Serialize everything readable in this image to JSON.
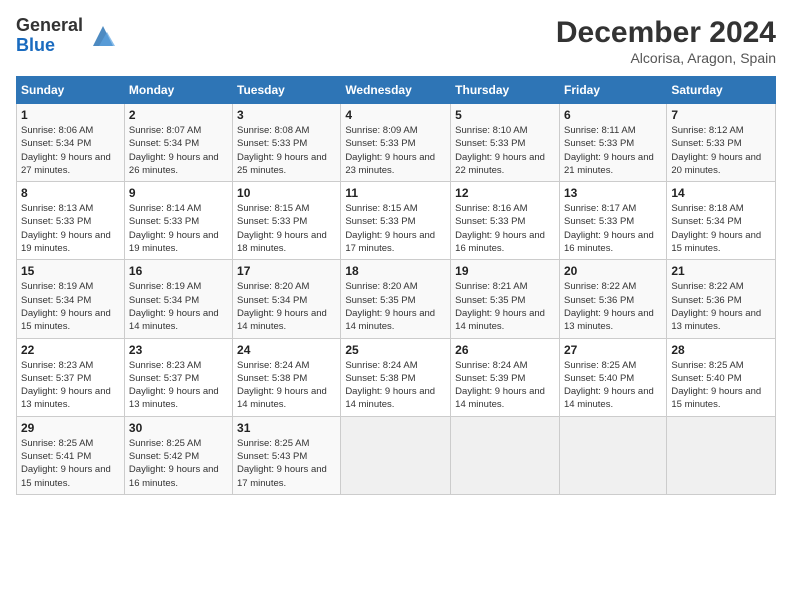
{
  "header": {
    "logo_line1": "General",
    "logo_line2": "Blue",
    "month": "December 2024",
    "location": "Alcorisa, Aragon, Spain"
  },
  "weekdays": [
    "Sunday",
    "Monday",
    "Tuesday",
    "Wednesday",
    "Thursday",
    "Friday",
    "Saturday"
  ],
  "weeks": [
    [
      {
        "day": "1",
        "sunrise": "8:06 AM",
        "sunset": "5:34 PM",
        "daylight": "9 hours and 27 minutes."
      },
      {
        "day": "2",
        "sunrise": "8:07 AM",
        "sunset": "5:34 PM",
        "daylight": "9 hours and 26 minutes."
      },
      {
        "day": "3",
        "sunrise": "8:08 AM",
        "sunset": "5:33 PM",
        "daylight": "9 hours and 25 minutes."
      },
      {
        "day": "4",
        "sunrise": "8:09 AM",
        "sunset": "5:33 PM",
        "daylight": "9 hours and 23 minutes."
      },
      {
        "day": "5",
        "sunrise": "8:10 AM",
        "sunset": "5:33 PM",
        "daylight": "9 hours and 22 minutes."
      },
      {
        "day": "6",
        "sunrise": "8:11 AM",
        "sunset": "5:33 PM",
        "daylight": "9 hours and 21 minutes."
      },
      {
        "day": "7",
        "sunrise": "8:12 AM",
        "sunset": "5:33 PM",
        "daylight": "9 hours and 20 minutes."
      }
    ],
    [
      {
        "day": "8",
        "sunrise": "8:13 AM",
        "sunset": "5:33 PM",
        "daylight": "9 hours and 19 minutes."
      },
      {
        "day": "9",
        "sunrise": "8:14 AM",
        "sunset": "5:33 PM",
        "daylight": "9 hours and 19 minutes."
      },
      {
        "day": "10",
        "sunrise": "8:15 AM",
        "sunset": "5:33 PM",
        "daylight": "9 hours and 18 minutes."
      },
      {
        "day": "11",
        "sunrise": "8:15 AM",
        "sunset": "5:33 PM",
        "daylight": "9 hours and 17 minutes."
      },
      {
        "day": "12",
        "sunrise": "8:16 AM",
        "sunset": "5:33 PM",
        "daylight": "9 hours and 16 minutes."
      },
      {
        "day": "13",
        "sunrise": "8:17 AM",
        "sunset": "5:33 PM",
        "daylight": "9 hours and 16 minutes."
      },
      {
        "day": "14",
        "sunrise": "8:18 AM",
        "sunset": "5:34 PM",
        "daylight": "9 hours and 15 minutes."
      }
    ],
    [
      {
        "day": "15",
        "sunrise": "8:19 AM",
        "sunset": "5:34 PM",
        "daylight": "9 hours and 15 minutes."
      },
      {
        "day": "16",
        "sunrise": "8:19 AM",
        "sunset": "5:34 PM",
        "daylight": "9 hours and 14 minutes."
      },
      {
        "day": "17",
        "sunrise": "8:20 AM",
        "sunset": "5:34 PM",
        "daylight": "9 hours and 14 minutes."
      },
      {
        "day": "18",
        "sunrise": "8:20 AM",
        "sunset": "5:35 PM",
        "daylight": "9 hours and 14 minutes."
      },
      {
        "day": "19",
        "sunrise": "8:21 AM",
        "sunset": "5:35 PM",
        "daylight": "9 hours and 14 minutes."
      },
      {
        "day": "20",
        "sunrise": "8:22 AM",
        "sunset": "5:36 PM",
        "daylight": "9 hours and 13 minutes."
      },
      {
        "day": "21",
        "sunrise": "8:22 AM",
        "sunset": "5:36 PM",
        "daylight": "9 hours and 13 minutes."
      }
    ],
    [
      {
        "day": "22",
        "sunrise": "8:23 AM",
        "sunset": "5:37 PM",
        "daylight": "9 hours and 13 minutes."
      },
      {
        "day": "23",
        "sunrise": "8:23 AM",
        "sunset": "5:37 PM",
        "daylight": "9 hours and 13 minutes."
      },
      {
        "day": "24",
        "sunrise": "8:24 AM",
        "sunset": "5:38 PM",
        "daylight": "9 hours and 14 minutes."
      },
      {
        "day": "25",
        "sunrise": "8:24 AM",
        "sunset": "5:38 PM",
        "daylight": "9 hours and 14 minutes."
      },
      {
        "day": "26",
        "sunrise": "8:24 AM",
        "sunset": "5:39 PM",
        "daylight": "9 hours and 14 minutes."
      },
      {
        "day": "27",
        "sunrise": "8:25 AM",
        "sunset": "5:40 PM",
        "daylight": "9 hours and 14 minutes."
      },
      {
        "day": "28",
        "sunrise": "8:25 AM",
        "sunset": "5:40 PM",
        "daylight": "9 hours and 15 minutes."
      }
    ],
    [
      {
        "day": "29",
        "sunrise": "8:25 AM",
        "sunset": "5:41 PM",
        "daylight": "9 hours and 15 minutes."
      },
      {
        "day": "30",
        "sunrise": "8:25 AM",
        "sunset": "5:42 PM",
        "daylight": "9 hours and 16 minutes."
      },
      {
        "day": "31",
        "sunrise": "8:25 AM",
        "sunset": "5:43 PM",
        "daylight": "9 hours and 17 minutes."
      },
      null,
      null,
      null,
      null
    ]
  ]
}
